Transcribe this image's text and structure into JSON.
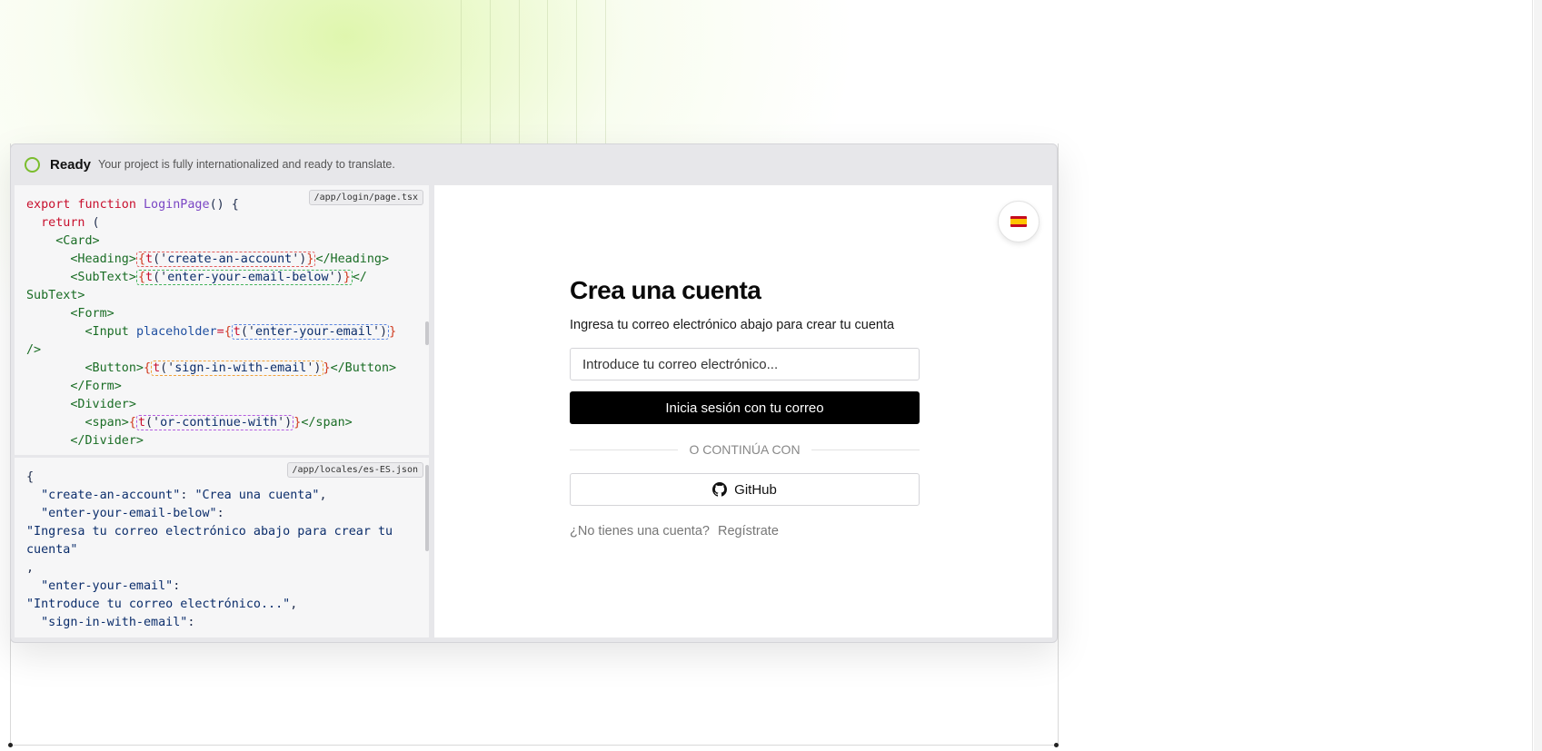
{
  "status": {
    "title": "Ready",
    "description": "Your project is fully internationalized and ready to translate."
  },
  "code_panel": {
    "file": "/app/login/page.tsx",
    "lines": {
      "l1_kw1": "export",
      "l1_kw2": "function",
      "l1_fn": "LoginPage",
      "l2_kw": "return",
      "l3": "<Card>",
      "l4_open": "<Heading>",
      "l4_key": "create-an-account",
      "l4_close": "</Heading>",
      "l5_open": "<SubText>",
      "l5_key": "enter-your-email-below",
      "l5_close": "</",
      "l6": "SubText>",
      "l7": "<Form>",
      "l8_tag": "<Input",
      "l8_attr": "placeholder",
      "l8_key": "enter-your-email",
      "l9": "/>",
      "l10_open": "<Button>",
      "l10_key": "sign-in-with-email",
      "l10_close": "</Button>",
      "l11": "</Form>",
      "l12": "<Divider>",
      "l13_open": "<span>",
      "l13_key": "or-continue-with",
      "l13_close": "</span>",
      "l14": "</Divider>"
    }
  },
  "json_panel": {
    "file": "/app/locales/es-ES.json",
    "entries": {
      "k1": "\"create-an-account\"",
      "v1": "\"Crea una cuenta\"",
      "k2": "\"enter-your-email-below\"",
      "v2a": "\"Ingresa tu correo electrónico abajo para crear tu",
      "v2b": "cuenta\"",
      "k3": "\"enter-your-email\"",
      "v3": "\"Introduce tu correo electrónico...\"",
      "k4": "\"sign-in-with-email\""
    }
  },
  "preview": {
    "language": "Spanish (es-ES)",
    "title": "Crea una cuenta",
    "subtitle": "Ingresa tu correo electrónico abajo para crear tu cuenta",
    "email_placeholder": "Introduce tu correo electrónico...",
    "sign_in_button": "Inicia sesión con tu correo",
    "divider_text": "O CONTINÚA CON",
    "github_button": "GitHub",
    "footer_text": "¿No tienes una cuenta?",
    "footer_link": "Regístrate"
  },
  "colors": {
    "status_green": "#7bbd2e",
    "primary_button": "#000000"
  }
}
